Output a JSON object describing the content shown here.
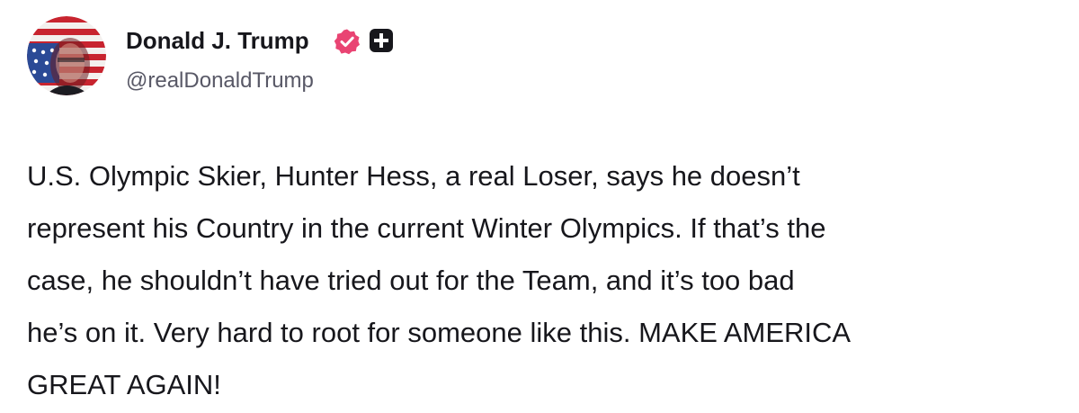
{
  "author": {
    "display_name": "Donald J. Trump",
    "handle": "@realDonaldTrump",
    "avatar_icon": "profile-photo-flag-portrait",
    "verified_icon": "verified-badge-icon",
    "verified_color": "#e94473",
    "platform_badge_icon": "truth-plus-icon",
    "platform_badge_color": "#17171c"
  },
  "post": {
    "lines": [
      "U.S. Olympic Skier, Hunter Hess, a real Loser, says he doesn’t",
      "represent his Country in the current Winter Olympics. If that’s the",
      "case, he shouldn’t have tried out for the Team, and it’s too bad",
      "he’s on it. Very hard to root for someone like this. MAKE AMERICA",
      "GREAT AGAIN!"
    ]
  }
}
